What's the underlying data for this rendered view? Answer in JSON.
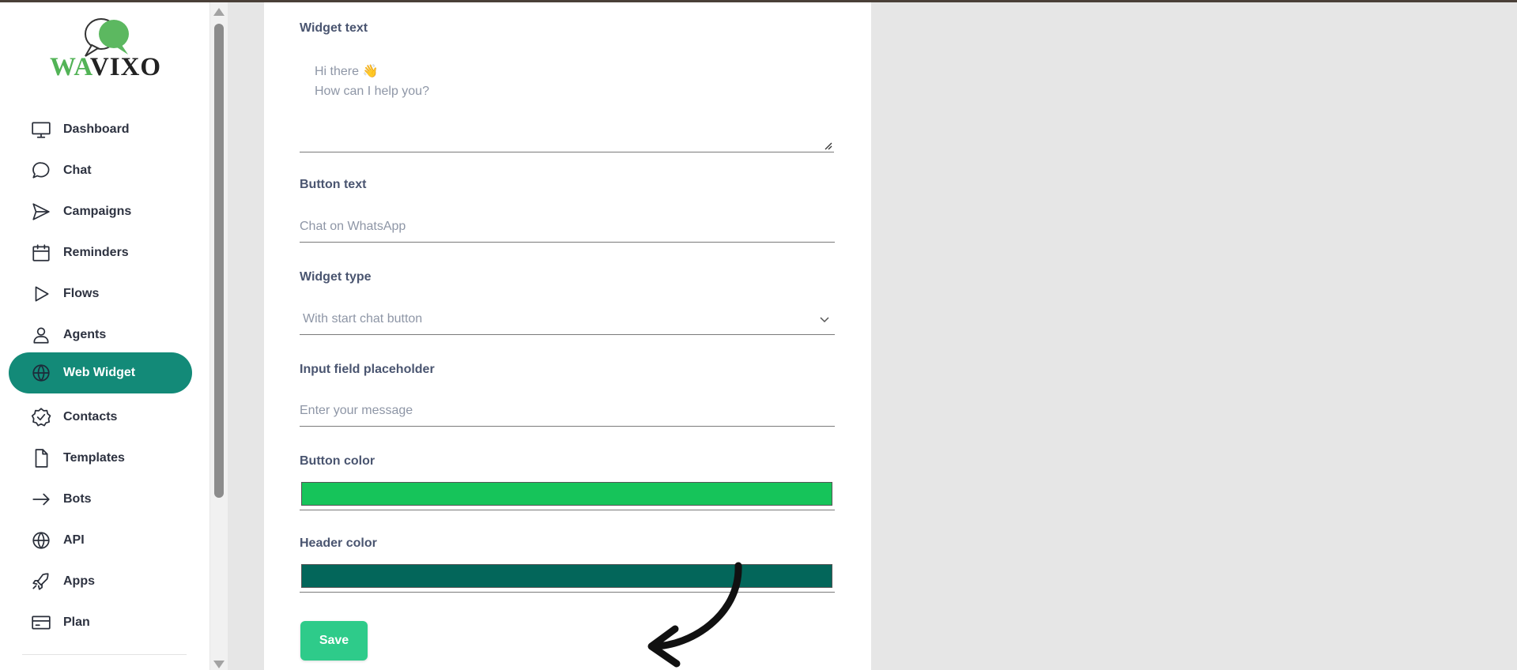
{
  "brand": {
    "part1": "WA",
    "part2": "VIXO"
  },
  "sidebar": {
    "items": [
      {
        "label": "Dashboard",
        "icon": "monitor-icon"
      },
      {
        "label": "Chat",
        "icon": "chat-bubble-icon"
      },
      {
        "label": "Campaigns",
        "icon": "send-icon"
      },
      {
        "label": "Reminders",
        "icon": "calendar-icon"
      },
      {
        "label": "Flows",
        "icon": "play-icon"
      },
      {
        "label": "Agents",
        "icon": "user-icon"
      },
      {
        "label": "Web Widget",
        "icon": "globe-icon",
        "active": true
      },
      {
        "label": "Contacts",
        "icon": "badge-check-icon"
      },
      {
        "label": "Templates",
        "icon": "file-icon"
      },
      {
        "label": "Bots",
        "icon": "arrow-right-icon"
      },
      {
        "label": "API",
        "icon": "globe-icon"
      },
      {
        "label": "Apps",
        "icon": "rocket-icon"
      },
      {
        "label": "Plan",
        "icon": "credit-card-icon"
      }
    ]
  },
  "form": {
    "widget_text": {
      "label": "Widget text",
      "value_line1": "Hi there 👋",
      "value_line2": "How can I help you?"
    },
    "button_text": {
      "label": "Button text",
      "value": "Chat on WhatsApp"
    },
    "widget_type": {
      "label": "Widget type",
      "value": "With start chat button"
    },
    "input_placeholder": {
      "label": "Input field placeholder",
      "value": "Enter your message"
    },
    "button_color": {
      "label": "Button color",
      "value": "#16c45a"
    },
    "header_color": {
      "label": "Header color",
      "value": "#03665a"
    },
    "save_label": "Save"
  },
  "colors": {
    "accent": "#138a78",
    "save_button": "#2ecb8a"
  }
}
